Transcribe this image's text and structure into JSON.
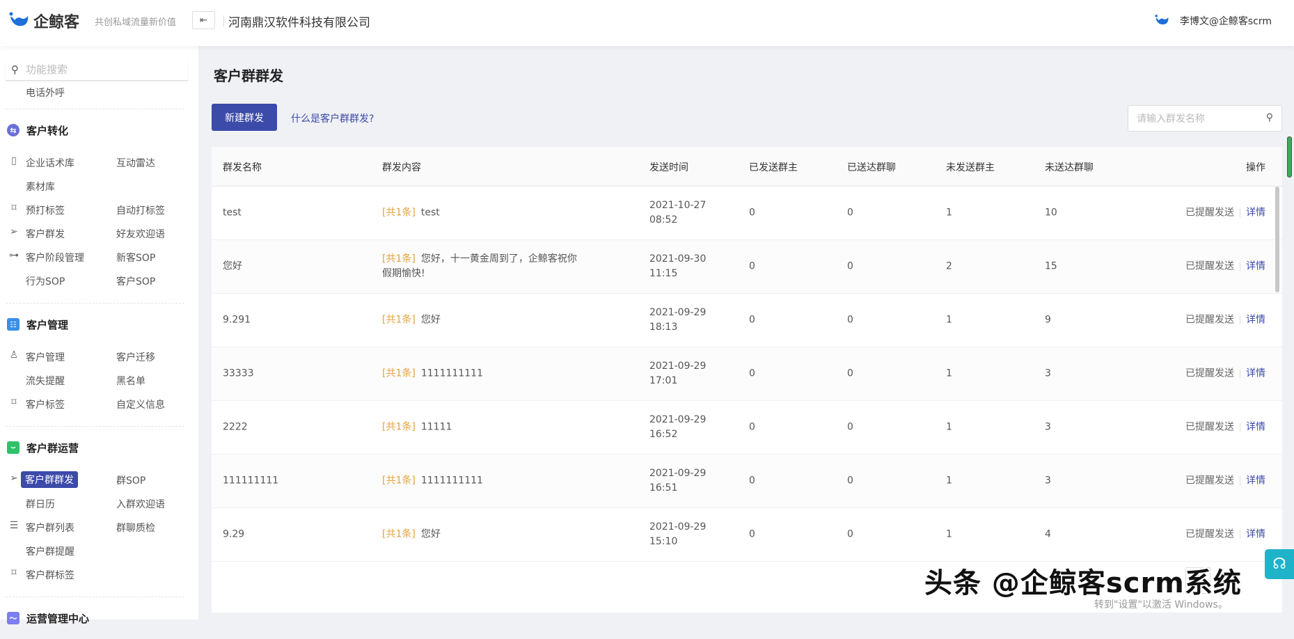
{
  "header": {
    "logo_text": "企鲸客",
    "slogan": "共创私域流量新价值",
    "company": "河南鼎汉软件科技有限公司",
    "user": "李博文@企鲸客scrm"
  },
  "sidebar": {
    "search_placeholder": "功能搜索",
    "top_item": "电话外呼",
    "sections": [
      {
        "title": "客户转化",
        "icon": "swap-icon",
        "color": "#6b6fd6",
        "rows": [
          {
            "icon": "book-icon",
            "glyph": "▯",
            "items": [
              "企业话术库",
              "互动雷达"
            ]
          },
          {
            "icon": "",
            "glyph": "",
            "items": [
              "素材库",
              ""
            ]
          },
          {
            "icon": "tag-icon",
            "glyph": "⌑",
            "items": [
              "预打标签",
              "自动打标签"
            ]
          },
          {
            "icon": "send-icon",
            "glyph": "➢",
            "items": [
              "客户群发",
              "好友欢迎语"
            ]
          },
          {
            "icon": "flow-icon",
            "glyph": "⊶",
            "items": [
              "客户阶段管理",
              "新客SOP"
            ]
          },
          {
            "icon": "",
            "glyph": "",
            "items": [
              "行为SOP",
              "客户SOP"
            ]
          }
        ]
      },
      {
        "title": "客户管理",
        "icon": "users-icon",
        "color": "#3a8ee6",
        "rows": [
          {
            "icon": "user-icon",
            "glyph": "♙",
            "items": [
              "客户管理",
              "客户迁移"
            ]
          },
          {
            "icon": "",
            "glyph": "",
            "items": [
              "流失提醒",
              "黑名单"
            ]
          },
          {
            "icon": "tag-icon",
            "glyph": "⌑",
            "items": [
              "客户标签",
              "自定义信息"
            ]
          }
        ]
      },
      {
        "title": "客户群运营",
        "icon": "chat-icon",
        "color": "#2fc26b",
        "rows": [
          {
            "icon": "send-icon",
            "glyph": "➢",
            "items": [
              "客户群群发",
              "群SOP"
            ],
            "active": 0
          },
          {
            "icon": "",
            "glyph": "",
            "items": [
              "群日历",
              "入群欢迎语"
            ]
          },
          {
            "icon": "list-icon",
            "glyph": "☰",
            "items": [
              "客户群列表",
              "群聊质检"
            ]
          },
          {
            "icon": "",
            "glyph": "",
            "items": [
              "客户群提醒",
              ""
            ]
          },
          {
            "icon": "tag-icon",
            "glyph": "⌑",
            "items": [
              "客户群标签",
              ""
            ]
          }
        ]
      },
      {
        "title": "运营管理中心",
        "icon": "monitor-icon",
        "color": "#7b7ef0",
        "rows": []
      }
    ]
  },
  "main": {
    "title": "客户群群发",
    "new_button": "新建群发",
    "help_link": "什么是客户群群发?",
    "search_placeholder": "请输入群发名称",
    "columns": [
      "群发名称",
      "群发内容",
      "发送时间",
      "已发送群主",
      "已送达群聊",
      "未发送群主",
      "未送达群聊",
      "操作"
    ],
    "rows": [
      {
        "name": "test",
        "tag": "[共1条]",
        "content": "test",
        "date": "2021-10-27",
        "time": "08:52",
        "sent_owner": "0",
        "delivered": "0",
        "unsent_owner": "1",
        "undelivered": "10",
        "remind": "已提醒发送",
        "detail": "详情"
      },
      {
        "name": "您好",
        "tag": "[共1条]",
        "content": "您好，十一黄金周到了，企鲸客祝你假期愉快!",
        "date": "2021-09-30",
        "time": "11:15",
        "sent_owner": "0",
        "delivered": "0",
        "unsent_owner": "2",
        "undelivered": "15",
        "remind": "已提醒发送",
        "detail": "详情"
      },
      {
        "name": "9.291",
        "tag": "[共1条]",
        "content": "您好",
        "date": "2021-09-29",
        "time": "18:13",
        "sent_owner": "0",
        "delivered": "0",
        "unsent_owner": "1",
        "undelivered": "9",
        "remind": "已提醒发送",
        "detail": "详情"
      },
      {
        "name": "33333",
        "tag": "[共1条]",
        "content": "1111111111",
        "date": "2021-09-29",
        "time": "17:01",
        "sent_owner": "0",
        "delivered": "0",
        "unsent_owner": "1",
        "undelivered": "3",
        "remind": "已提醒发送",
        "detail": "详情"
      },
      {
        "name": "2222",
        "tag": "[共1条]",
        "content": "11111",
        "date": "2021-09-29",
        "time": "16:52",
        "sent_owner": "0",
        "delivered": "0",
        "unsent_owner": "1",
        "undelivered": "3",
        "remind": "已提醒发送",
        "detail": "详情"
      },
      {
        "name": "111111111",
        "tag": "[共1条]",
        "content": "1111111111",
        "date": "2021-09-29",
        "time": "16:51",
        "sent_owner": "0",
        "delivered": "0",
        "unsent_owner": "1",
        "undelivered": "3",
        "remind": "已提醒发送",
        "detail": "详情"
      },
      {
        "name": "9.29",
        "tag": "[共1条]",
        "content": "您好",
        "date": "2021-09-29",
        "time": "15:10",
        "sent_owner": "0",
        "delivered": "0",
        "unsent_owner": "1",
        "undelivered": "4",
        "remind": "已提醒发送",
        "detail": "详情"
      }
    ]
  },
  "overlay": {
    "watermark": "头条 @企鲸客scrm系统",
    "windows_activation": "转到\"设置\"以激活 Windows。"
  },
  "colors": {
    "primary": "#3c4aa9",
    "tag": "#e6a23c",
    "support": "#1fb3c9"
  }
}
